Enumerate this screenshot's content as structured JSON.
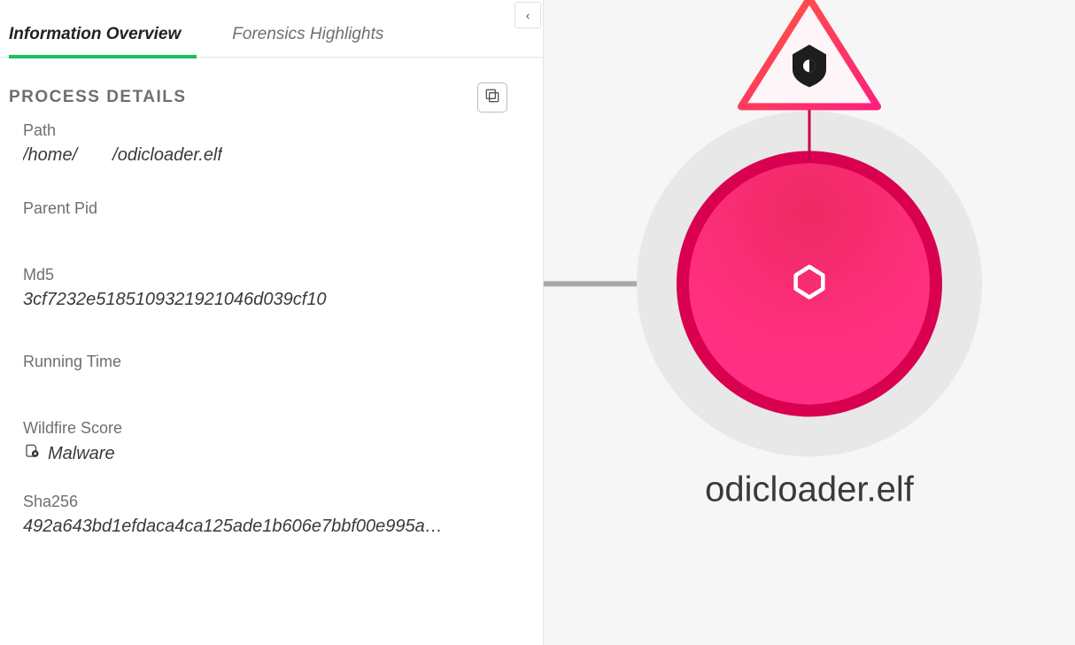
{
  "tabs": {
    "overview": "Information Overview",
    "forensics": "Forensics Highlights"
  },
  "section": {
    "title": "PROCESS DETAILS"
  },
  "fields": {
    "path": {
      "label": "Path",
      "prefix": "/home/",
      "suffix": "/odicloader.elf"
    },
    "parentPid": {
      "label": "Parent Pid",
      "value": ""
    },
    "md5": {
      "label": "Md5",
      "value": "3cf7232e5185109321921046d039cf10"
    },
    "runningTime": {
      "label": "Running Time",
      "value": ""
    },
    "wildfire": {
      "label": "Wildfire Score",
      "value": "Malware"
    },
    "sha256": {
      "label": "Sha256",
      "value": "492a643bd1efdaca4ca125ade1b606e7bbf00e995a…"
    }
  },
  "node": {
    "label": "odicloader.elf"
  },
  "colors": {
    "accent": "#15c15d",
    "nodeBorder": "#d9004f",
    "nodeFillA": "#ef2a64",
    "nodeFillB": "#ff2f8a"
  }
}
